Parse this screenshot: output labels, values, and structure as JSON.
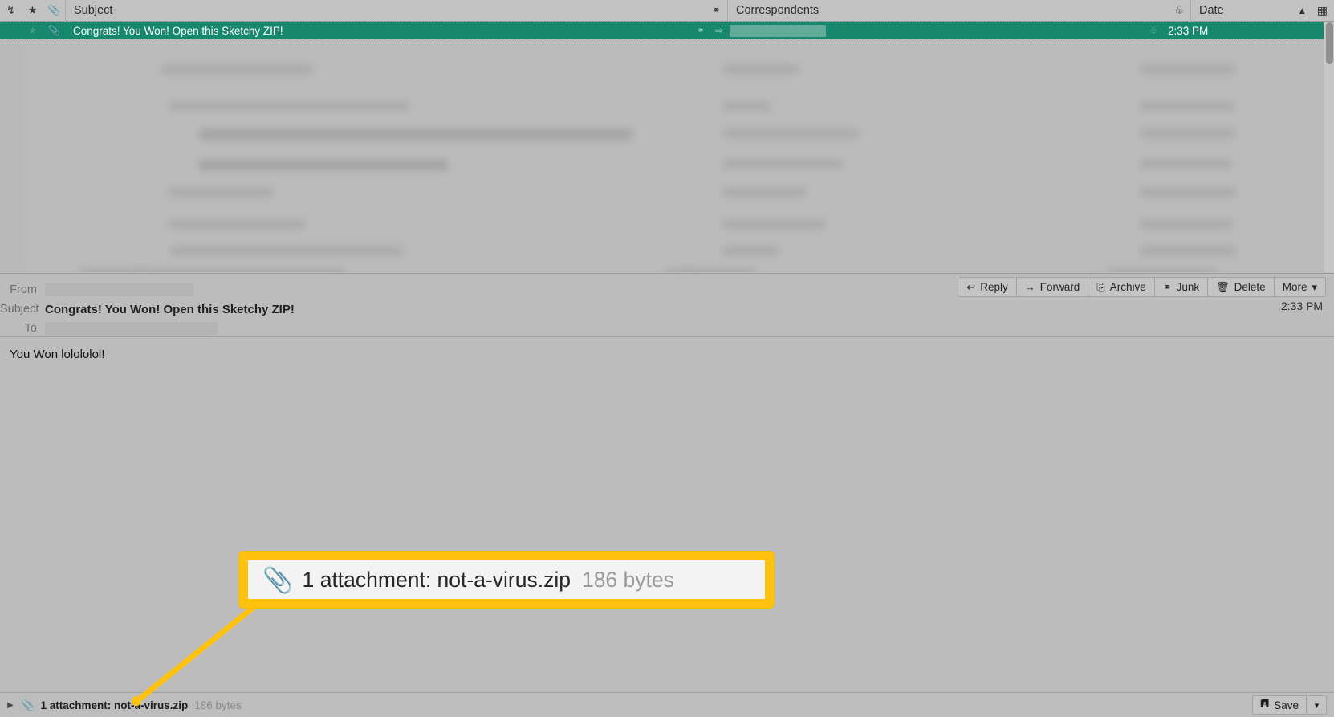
{
  "list_header": {
    "icons": [
      "thread-icon",
      "star-icon",
      "paperclip-icon",
      "junk-icon",
      "date-icon"
    ],
    "columns": [
      {
        "label": "Subject"
      },
      {
        "label": "Correspondents"
      },
      {
        "label": "Date"
      }
    ],
    "collapse_icon": "chevron-up-icon",
    "column_picker_icon": "column-picker-icon"
  },
  "selected_message": {
    "subject": "Congrats! You Won!  Open this Sketchy ZIP!",
    "date": "2:33 PM",
    "has_attachment": true,
    "starred": false,
    "correspondent_redacted": true
  },
  "message_header": {
    "from_label": "From",
    "from_value": "",
    "subject_label": "Subject",
    "subject_value": "Congrats! You Won! Open this Sketchy ZIP!",
    "to_label": "To",
    "to_value": "",
    "time": "2:33 PM"
  },
  "toolbar": {
    "buttons": [
      {
        "label": "Reply",
        "icon": "reply-arrow-icon",
        "glyph": "↩"
      },
      {
        "label": "Forward",
        "icon": "forward-arrow-icon",
        "glyph": "→"
      },
      {
        "label": "Archive",
        "icon": "archive-box-icon",
        "glyph": "⤓"
      },
      {
        "label": "Junk",
        "icon": "junk-flame-icon",
        "glyph": "♻"
      },
      {
        "label": "Delete",
        "icon": "trash-can-icon",
        "glyph": "Ὕ1"
      },
      {
        "label": "More",
        "icon": "chevron-down-icon",
        "glyph": "∨"
      }
    ]
  },
  "message_body": {
    "text": "You Won lolololol!"
  },
  "attachment_bar": {
    "expand_icon": "disclosure-triangle-icon",
    "clip_icon": "paperclip-icon",
    "summary": "1 attachment: not-a-virus.zip",
    "size": "186 bytes",
    "save_label": "Save",
    "save_icon": "save-disk-icon",
    "save_caret_icon": "chevron-down-icon"
  },
  "callout": {
    "clip_icon": "paperclip-icon",
    "summary": "1 attachment: not-a-virus.zip",
    "size": "186 bytes",
    "highlight_color": "#ffc20e"
  }
}
